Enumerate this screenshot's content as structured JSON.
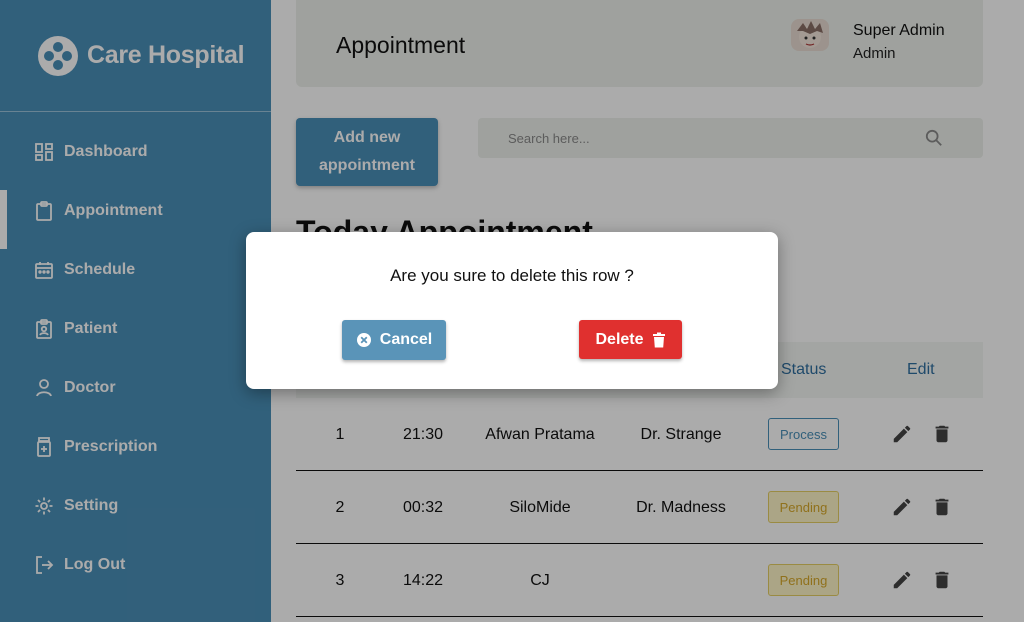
{
  "brand": {
    "name": "Care Hospital"
  },
  "sidebar": {
    "items": [
      {
        "label": "Dashboard",
        "icon": "dashboard-icon"
      },
      {
        "label": "Appointment",
        "icon": "clipboard-icon",
        "active": true
      },
      {
        "label": "Schedule",
        "icon": "calendar-icon"
      },
      {
        "label": "Patient",
        "icon": "patient-badge-icon"
      },
      {
        "label": "Doctor",
        "icon": "person-icon"
      },
      {
        "label": "Prescription",
        "icon": "medicine-icon"
      },
      {
        "label": "Setting",
        "icon": "gear-icon"
      },
      {
        "label": "Log Out",
        "icon": "logout-icon"
      }
    ]
  },
  "header": {
    "title": "Appointment"
  },
  "user": {
    "name": "Super Admin",
    "role": "Admin"
  },
  "actions": {
    "add_label": "Add new appointment"
  },
  "search": {
    "placeholder": "Search here..."
  },
  "section": {
    "title": "Today Appointment"
  },
  "table": {
    "headers": {
      "status": "Status",
      "edit": "Edit"
    },
    "rows": [
      {
        "no": "1",
        "time": "21:30",
        "patient": "Afwan Pratama",
        "doctor": "Dr. Strange",
        "status": "Process"
      },
      {
        "no": "2",
        "time": "00:32",
        "patient": "SiloMide",
        "doctor": "Dr. Madness",
        "status": "Pending"
      },
      {
        "no": "3",
        "time": "14:22",
        "patient": "CJ",
        "doctor": "",
        "status": "Pending"
      }
    ]
  },
  "modal": {
    "message": "Are you sure to delete this row ?",
    "cancel_label": "Cancel",
    "delete_label": "Delete"
  },
  "colors": {
    "primary": "#4a8fb8",
    "danger": "#e0302f",
    "pending": "#d7a92a"
  }
}
